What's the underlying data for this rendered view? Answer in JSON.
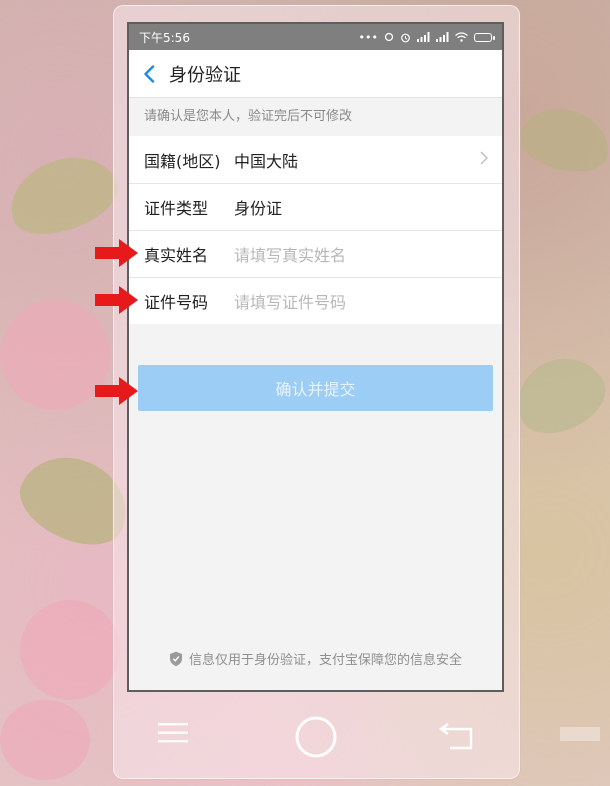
{
  "status_bar": {
    "time": "下午5:56",
    "icons": [
      "more-dots-icon",
      "sync-icon",
      "alarm-icon",
      "signal-icon",
      "signal-icon",
      "wifi-icon",
      "battery-icon"
    ]
  },
  "header": {
    "title": "身份验证",
    "back_icon": "chevron-left-icon"
  },
  "notice": "请确认是您本人，验证完后不可修改",
  "form": {
    "nationality": {
      "label": "国籍(地区)",
      "value": "中国大陆"
    },
    "id_type": {
      "label": "证件类型",
      "value": "身份证"
    },
    "real_name": {
      "label": "真实姓名",
      "placeholder": "请填写真实姓名"
    },
    "id_number": {
      "label": "证件号码",
      "placeholder": "请填写证件号码"
    }
  },
  "submit_label": "确认并提交",
  "footer": "信息仅用于身份验证，支付宝保障您的信息安全",
  "colors": {
    "accent": "#1a8ce8",
    "submit_disabled": "#9ccef5",
    "arrow": "#e8191a"
  }
}
